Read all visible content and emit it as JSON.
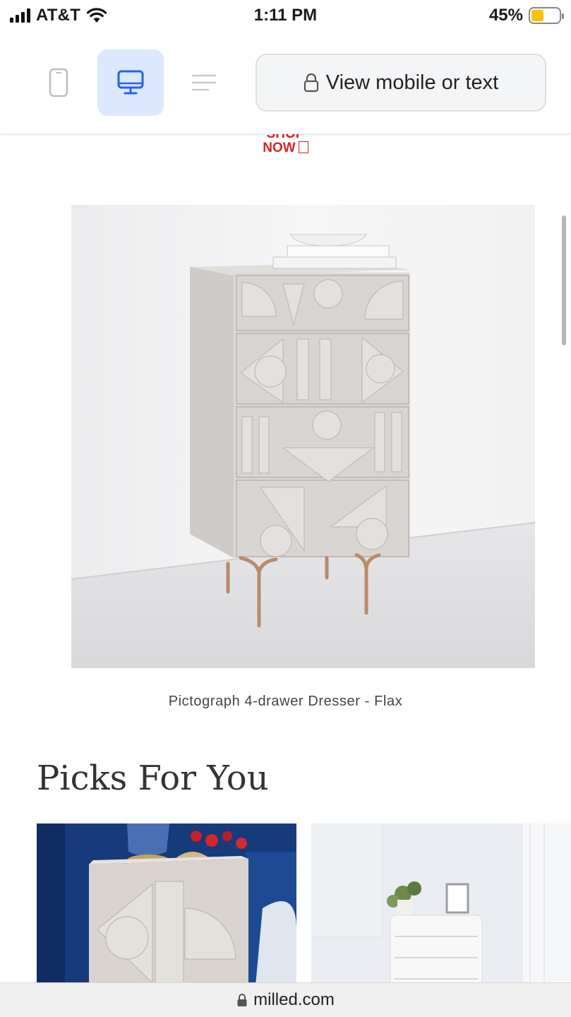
{
  "status_bar": {
    "carrier": "AT&T",
    "time": "1:11 PM",
    "battery_percent": "45%",
    "battery_level": 0.45,
    "battery_color": "#f5c400"
  },
  "toolbar": {
    "icons": [
      "phone-icon",
      "desktop-icon",
      "text-lines-icon",
      "lock-icon"
    ],
    "view_mobile_label": "View mobile or text",
    "active_color": "#dbe8fd"
  },
  "promo": {
    "shop_now_label": "NOW",
    "shop_now_top": "SHOP",
    "accent_color": "#e02020"
  },
  "product": {
    "caption": "Pictograph 4-drawer Dresser - Flax"
  },
  "picks": {
    "heading": "Picks For You"
  },
  "browser": {
    "url": "milled.com"
  }
}
